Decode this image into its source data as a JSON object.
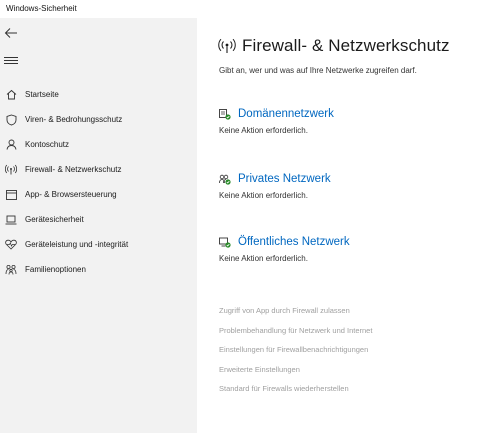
{
  "window": {
    "title": "Windows-Sicherheit"
  },
  "sidebar": {
    "items": [
      {
        "label": "Startseite",
        "icon": "home-icon"
      },
      {
        "label": "Viren- & Bedrohungsschutz",
        "icon": "shield-icon"
      },
      {
        "label": "Kontoschutz",
        "icon": "person-icon"
      },
      {
        "label": "Firewall- & Netzwerkschutz",
        "icon": "wifi-antenna-icon",
        "selected": true
      },
      {
        "label": "App- & Browsersteuerung",
        "icon": "app-window-icon"
      },
      {
        "label": "Gerätesicherheit",
        "icon": "laptop-icon"
      },
      {
        "label": "Geräteleistung und -integrität",
        "icon": "heart-pulse-icon"
      },
      {
        "label": "Familienoptionen",
        "icon": "family-icon"
      }
    ]
  },
  "main": {
    "title": "Firewall- & Netzwerkschutz",
    "subtitle": "Gibt an, wer und was auf Ihre Netzwerke zugreifen darf.",
    "networks": [
      {
        "name": "Domänennetzwerk",
        "status": "Keine Aktion erforderlich."
      },
      {
        "name": "Privates Netzwerk",
        "status": "Keine Aktion erforderlich."
      },
      {
        "name": "Öffentliches Netzwerk",
        "status": "Keine Aktion erforderlich."
      }
    ],
    "links": [
      "Zugriff von App durch Firewall zulassen",
      "Problembehandlung für Netzwerk und Internet",
      "Einstellungen für Firewallbenachrichtigungen",
      "Erweiterte Einstellungen",
      "Standard für Firewalls wiederherstellen"
    ]
  },
  "colors": {
    "accent": "#0067c0",
    "sidebar_bg": "#f2f2f2",
    "ok_green": "#2a8b2a",
    "link_gray": "#a0a0a0"
  }
}
